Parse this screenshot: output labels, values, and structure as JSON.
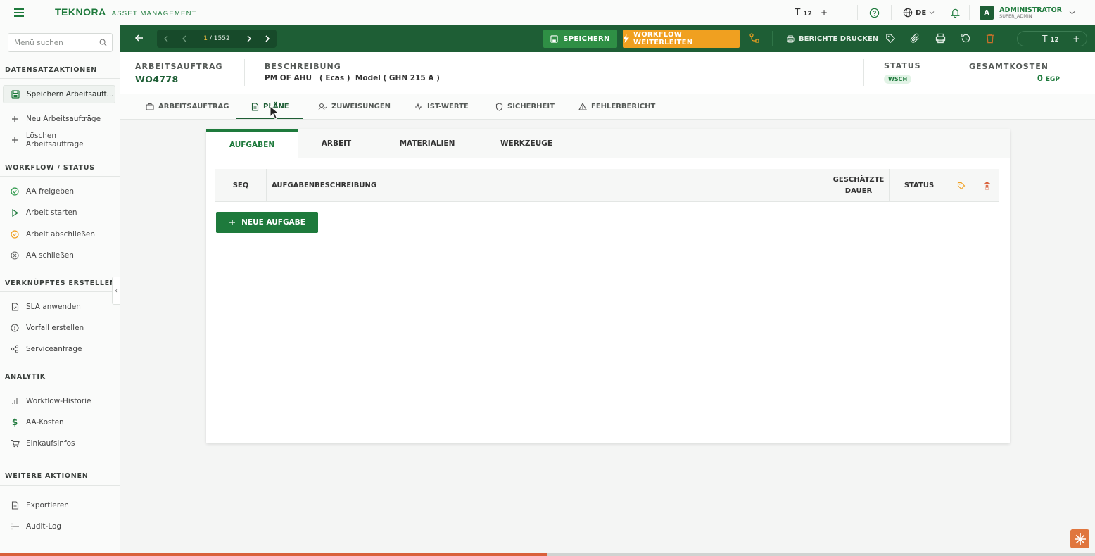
{
  "topbar": {
    "brand_name": "TEKNORA",
    "brand_sub": "ASSET MANAGEMENT",
    "font_size": "12",
    "language": "DE",
    "avatar_letter": "A",
    "user_name": "ADMINISTRATOR",
    "user_role": "SUPER_ADMIN"
  },
  "sidebar": {
    "search_placeholder": "Menü suchen",
    "sections": {
      "record": "DATENSATZAKTIONEN",
      "workflow": "WORKFLOW / STATUS",
      "linked": "VERKNÜPFTES ERSTELLEN",
      "analytics": "ANALYTIK",
      "more": "WEITERE AKTIONEN"
    },
    "items": {
      "save": "Speichern Arbeitsauft...",
      "new": "Neu Arbeitsaufträge",
      "delete": "Löschen Arbeitsaufträge",
      "release": "AA freigeben",
      "start": "Arbeit starten",
      "finish": "Arbeit abschließen",
      "close": "AA schließen",
      "sla": "SLA anwenden",
      "incident": "Vorfall erstellen",
      "service": "Serviceanfrage",
      "history": "Workflow-Historie",
      "costs": "AA-Kosten",
      "purchase": "Einkaufsinfos",
      "export": "Exportieren",
      "audit": "Audit-Log"
    }
  },
  "toolbar": {
    "page_current": "1",
    "page_total": "/ 1552",
    "save_label": "SPEICHERN",
    "workflow_label": "WORKFLOW WEITERLEITEN",
    "reports_label": "BERICHTE DRUCKEN",
    "font_size": "12"
  },
  "header": {
    "wo_label": "ARBEITSAUFTRAG",
    "wo_value": "WO4778",
    "desc_label": "BESCHREIBUNG",
    "desc_value": "PM OF AHU   ( Ecas )  Model ( GHN 215 A )",
    "status_label": "STATUS",
    "status_value": "WSCH",
    "cost_label": "GESAMTKOSTEN",
    "cost_value": "0",
    "cost_currency": "EGP"
  },
  "tabs": {
    "order": "ARBEITSAUFTRAG",
    "plans": "PLÄNE",
    "assignments": "ZUWEISUNGEN",
    "actuals": "IST-WERTE",
    "safety": "SICHERHEIT",
    "failure": "FEHLERBERICHT"
  },
  "subtabs": {
    "tasks": "AUFGABEN",
    "labor": "ARBEIT",
    "materials": "MATERIALIEN",
    "tools": "WERKZEUGE"
  },
  "table": {
    "seq": "SEQ",
    "description": "AUFGABENBESCHREIBUNG",
    "duration": "GESCHÄTZTE DAUER",
    "status": "STATUS"
  },
  "new_task_label": "NEUE AUFGABE",
  "progress": 0.5,
  "colors": {
    "primary": "#1e5e35",
    "accent": "#1e7a3c",
    "warning": "#f0a020",
    "danger": "#d9603a"
  }
}
